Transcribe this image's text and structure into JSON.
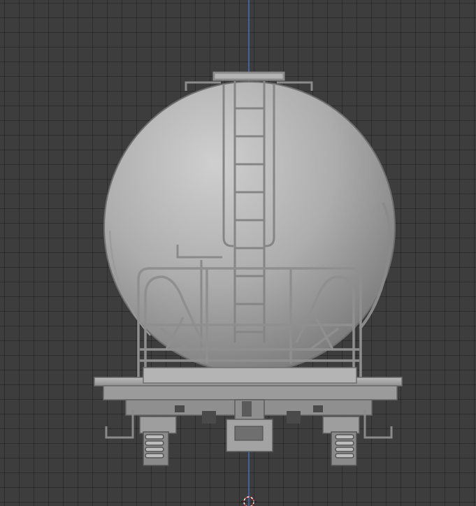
{
  "viewport": {
    "background": "#3d3d3d",
    "grid_color": "#2e2e2e",
    "z_axis_color": "#4a7ddb",
    "model_color": "#a9a9a9",
    "model_shadow": "#7d7d7d",
    "model_highlight": "#cfcfcf",
    "object_origin_icon": "3d-cursor-icon"
  }
}
